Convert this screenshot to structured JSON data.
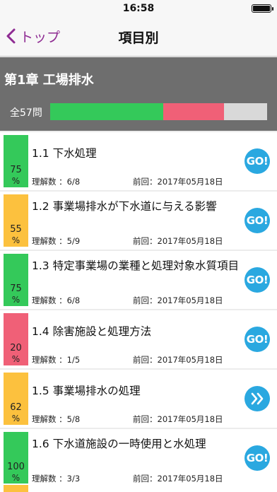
{
  "status_bar": {
    "time": "16:58"
  },
  "nav": {
    "back_label": "トップ",
    "title": "項目別"
  },
  "chapter": {
    "title": "第1章 工場排水",
    "total_label": "全57問",
    "progress": {
      "correct_fraction": 0.52,
      "wrong_fraction": 0.28
    },
    "colors": {
      "correct": "#34c95a",
      "wrong": "#f06077",
      "remaining": "#d9d9d9"
    }
  },
  "labels": {
    "understanding_prefix": "理解数 ：",
    "previous_prefix": "前回：",
    "go": "GO!"
  },
  "items": [
    {
      "title": "1.1 下水処理",
      "percent": "75",
      "unit": "%",
      "color": "#34c95a",
      "understanding": "6/8",
      "previous": "2017年05月18日",
      "action": "go"
    },
    {
      "title": "1.2 事業場排水が下水道に与える影響",
      "percent": "55",
      "unit": "%",
      "color": "#fcc13e",
      "understanding": "5/9",
      "previous": "2017年05月18日",
      "action": "go"
    },
    {
      "title": "1.3 特定事業場の業種と処理対象水質項目",
      "percent": "75",
      "unit": "%",
      "color": "#34c95a",
      "understanding": "6/8",
      "previous": "2017年05月18日",
      "action": "go"
    },
    {
      "title": "1.4 除害施設と処理方法",
      "percent": "20",
      "unit": "%",
      "color": "#f06077",
      "understanding": "1/5",
      "previous": "2017年05月18日",
      "action": "go"
    },
    {
      "title": "1.5 事業場排水の処理",
      "percent": "62",
      "unit": "%",
      "color": "#fcc13e",
      "understanding": "5/8",
      "previous": "2017年05月18日",
      "action": "next"
    },
    {
      "title": "1.6 下水道施設の一時使用と水処理",
      "percent": "100",
      "unit": "%",
      "color": "#34c95a",
      "understanding": "3/3",
      "previous": "2017年05月18日",
      "action": "go"
    }
  ]
}
